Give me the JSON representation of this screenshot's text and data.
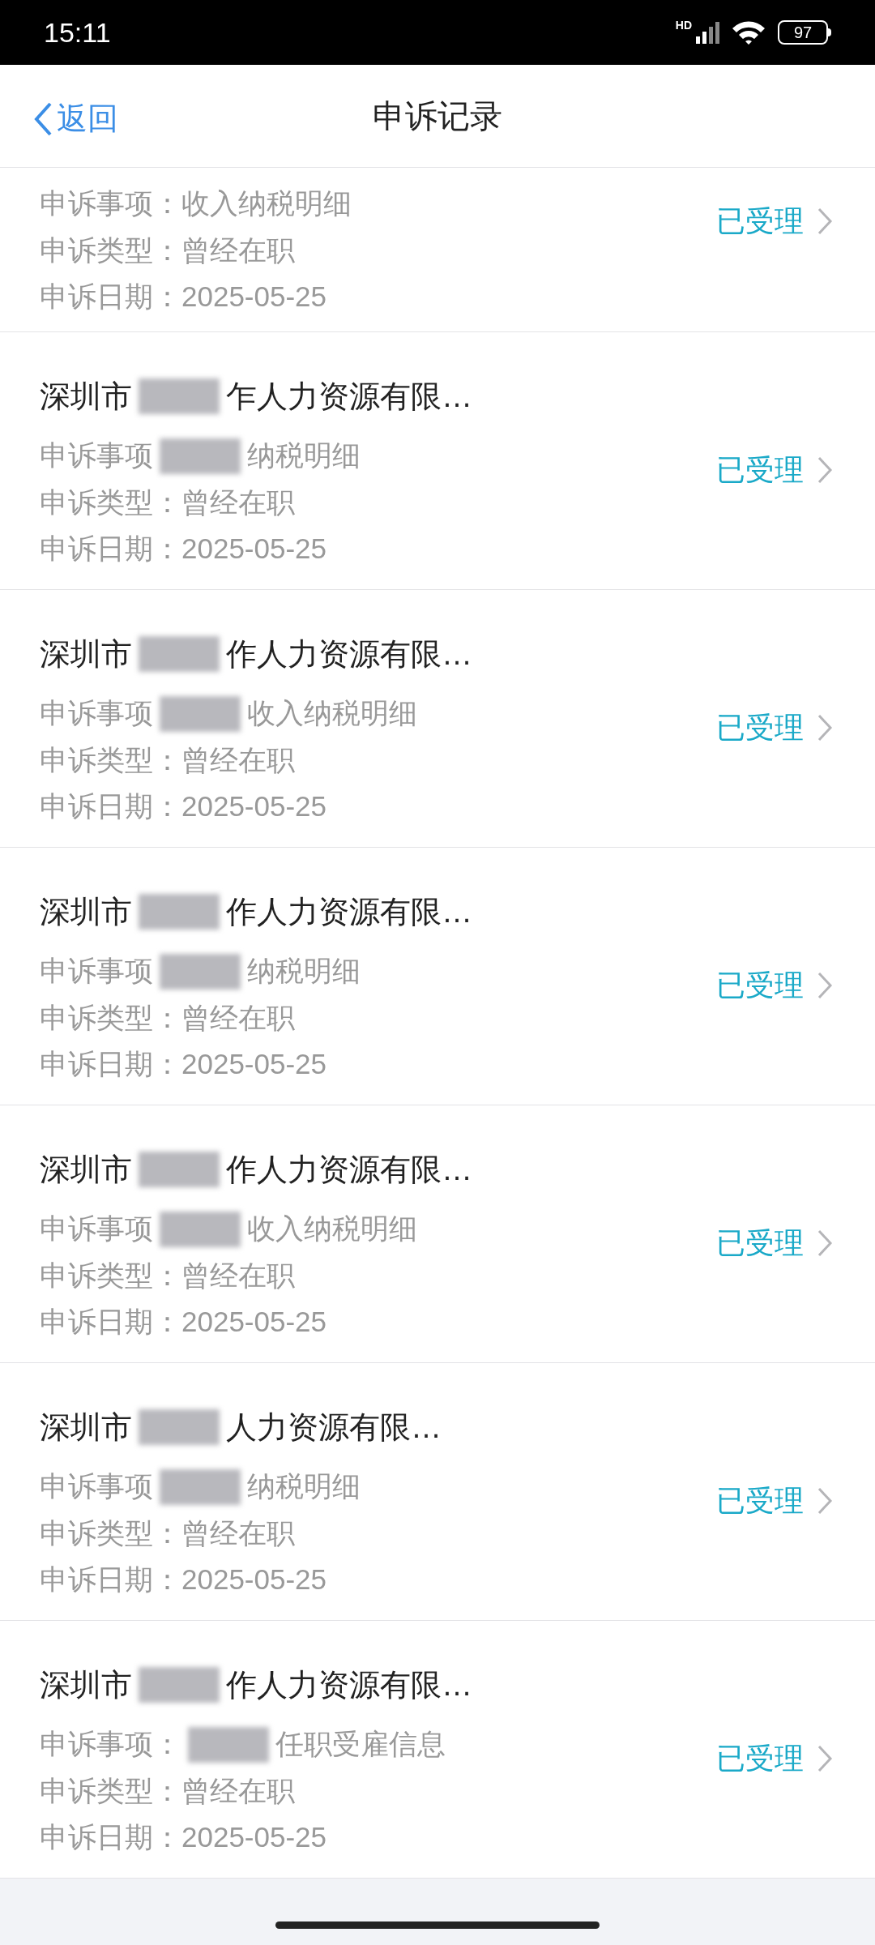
{
  "status_bar": {
    "time": "15:11",
    "network": "HD",
    "battery": "97"
  },
  "nav": {
    "back": "返回",
    "title": "申诉记录"
  },
  "records": [
    {
      "subject_parts": [
        "申诉事项：收入纳税明细"
      ],
      "type": "申诉类型：曾经在职",
      "date": "申诉日期：2025-05-25",
      "status": "已受理"
    },
    {
      "name_parts": [
        "深圳市",
        "乍人力资源有限…"
      ],
      "subject_parts": [
        "申诉事项",
        "纳税明细"
      ],
      "type": "申诉类型：曾经在职",
      "date": "申诉日期：2025-05-25",
      "status": "已受理"
    },
    {
      "name_parts": [
        "深圳市",
        "作人力资源有限…"
      ],
      "subject_parts": [
        "申诉事项",
        "收入纳税明细"
      ],
      "type": "申诉类型：曾经在职",
      "date": "申诉日期：2025-05-25",
      "status": "已受理"
    },
    {
      "name_parts": [
        "深圳市",
        "作人力资源有限…"
      ],
      "subject_parts": [
        "申诉事项",
        "纳税明细"
      ],
      "type": "申诉类型：曾经在职",
      "date": "申诉日期：2025-05-25",
      "status": "已受理"
    },
    {
      "name_parts": [
        "深圳市",
        "作人力资源有限…"
      ],
      "subject_parts": [
        "申诉事项",
        "收入纳税明细"
      ],
      "type": "申诉类型：曾经在职",
      "date": "申诉日期：2025-05-25",
      "status": "已受理"
    },
    {
      "name_parts": [
        "深圳市",
        "人力资源有限…"
      ],
      "subject_parts": [
        "申诉事项",
        "纳税明细"
      ],
      "type": "申诉类型：曾经在职",
      "date": "申诉日期：2025-05-25",
      "status": "已受理"
    },
    {
      "name_parts": [
        "深圳市",
        "作人力资源有限…"
      ],
      "subject_parts": [
        "申诉事项：",
        "任职受雇信息"
      ],
      "type": "申诉类型：曾经在职",
      "date": "申诉日期：2025-05-25",
      "status": "已受理"
    }
  ]
}
